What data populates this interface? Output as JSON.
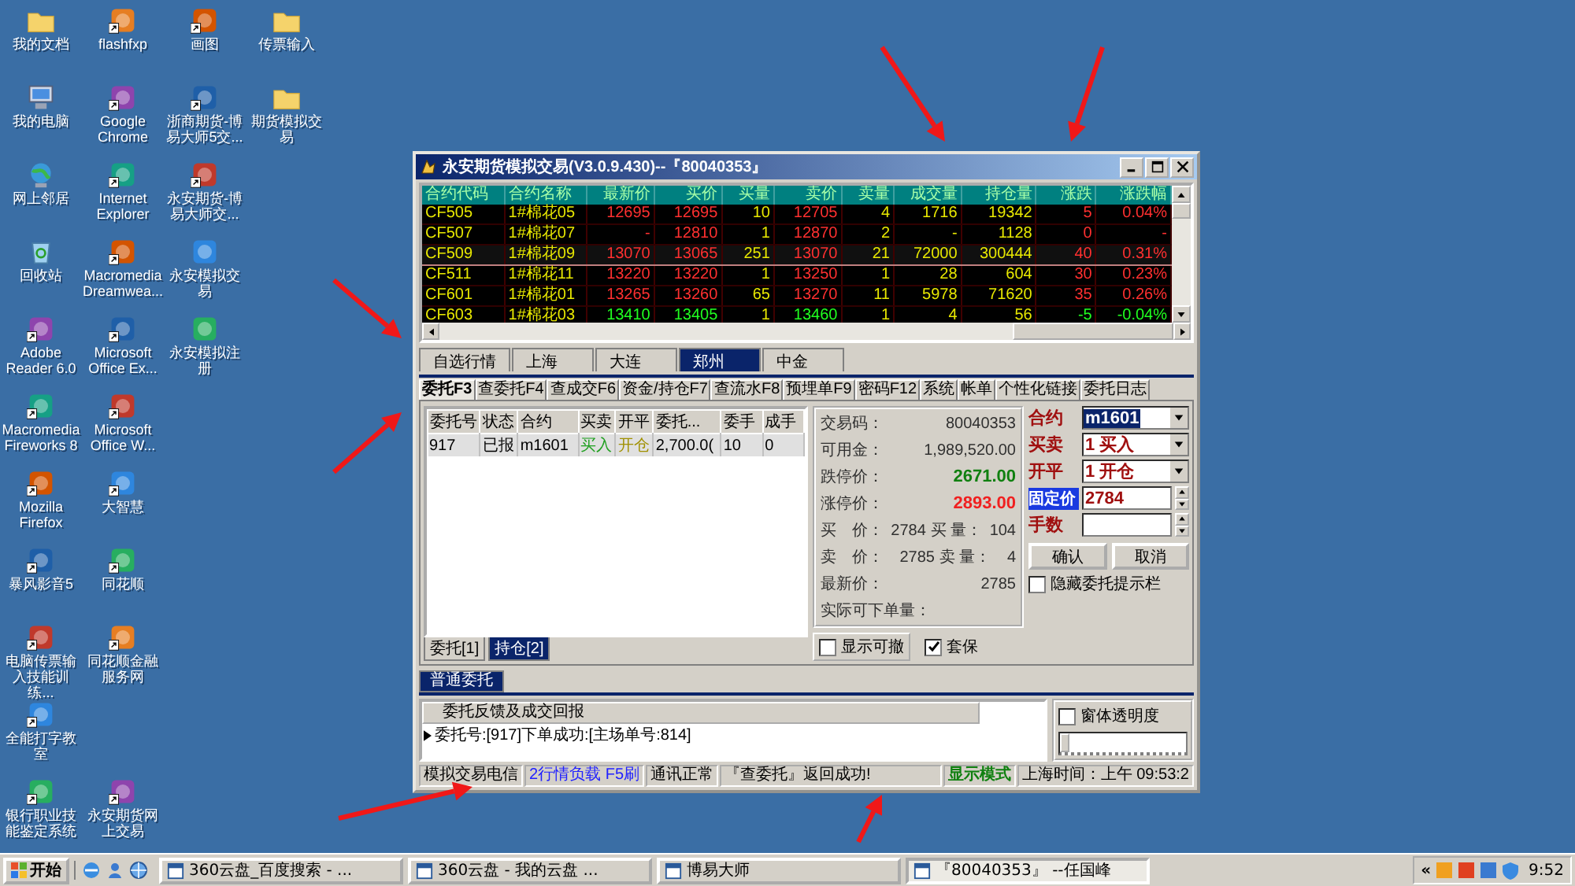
{
  "desktop_columns": [
    [
      {
        "label": "我的文档",
        "shortcut": false
      },
      {
        "label": "我的电脑",
        "shortcut": false
      },
      {
        "label": "网上邻居",
        "shortcut": false
      },
      {
        "label": "回收站",
        "shortcut": false
      },
      {
        "label": "Adobe Reader 6.0",
        "shortcut": true
      },
      {
        "label": "Macromedia Fireworks 8",
        "shortcut": true
      },
      {
        "label": "Mozilla Firefox",
        "shortcut": true
      },
      {
        "label": "暴风影音5",
        "shortcut": true
      },
      {
        "label": "电脑传票输入技能训练...",
        "shortcut": true
      },
      {
        "label": "全能打字教室",
        "shortcut": true
      },
      {
        "label": "银行职业技能鉴定系统",
        "shortcut": true
      }
    ],
    [
      {
        "label": "flashfxp",
        "shortcut": true
      },
      {
        "label": "Google Chrome",
        "shortcut": true
      },
      {
        "label": "Internet Explorer",
        "shortcut": true
      },
      {
        "label": "Macromedia Dreamwea...",
        "shortcut": true
      },
      {
        "label": "Microsoft Office Ex...",
        "shortcut": true
      },
      {
        "label": "Microsoft Office W...",
        "shortcut": true
      },
      {
        "label": "大智慧",
        "shortcut": true
      },
      {
        "label": "同花顺",
        "shortcut": true
      },
      {
        "label": "同花顺金融服务网",
        "shortcut": true
      },
      {
        "label": "永安期货网上交易",
        "shortcut": true
      }
    ],
    [
      {
        "label": "画图",
        "shortcut": true
      },
      {
        "label": "浙商期货-博易大师5交...",
        "shortcut": true
      },
      {
        "label": "永安期货-博易大师交...",
        "shortcut": true
      },
      {
        "label": "永安模拟交易",
        "shortcut": false
      },
      {
        "label": "永安模拟注册",
        "shortcut": false
      }
    ],
    [
      {
        "label": "传票输入",
        "shortcut": false
      },
      {
        "label": "期货模拟交易",
        "shortcut": false
      }
    ]
  ],
  "window": {
    "title": "永安期货模拟交易(V3.0.9.430)--『80040353』"
  },
  "market": {
    "columns": [
      "合约代码",
      "合约名称",
      "最新价",
      "买价",
      "买量",
      "卖价",
      "卖量",
      "成交量",
      "持仓量",
      "涨跌",
      "涨跌幅"
    ],
    "rows": [
      {
        "code": "CF505",
        "name": "1#棉花05",
        "last": "12695",
        "bid": "12695",
        "bid_vol": "10",
        "ask": "12705",
        "ask_vol": "4",
        "volume": "1716",
        "open_interest": "19342",
        "change": "5",
        "change_pct": "0.04%",
        "color": "#ff3030",
        "selected": false
      },
      {
        "code": "CF507",
        "name": "1#棉花07",
        "last": "-",
        "bid": "12810",
        "bid_vol": "1",
        "ask": "12870",
        "ask_vol": "2",
        "volume": "-",
        "open_interest": "1128",
        "change": "0",
        "change_pct": "-",
        "color": "#ff3030",
        "selected": false
      },
      {
        "code": "CF509",
        "name": "1#棉花09",
        "last": "13070",
        "bid": "13065",
        "bid_vol": "251",
        "ask": "13070",
        "ask_vol": "21",
        "volume": "72000",
        "open_interest": "300444",
        "change": "40",
        "change_pct": "0.31%",
        "color": "#ff3030",
        "selected": true
      },
      {
        "code": "CF511",
        "name": "1#棉花11",
        "last": "13220",
        "bid": "13220",
        "bid_vol": "1",
        "ask": "13250",
        "ask_vol": "1",
        "volume": "28",
        "open_interest": "604",
        "change": "30",
        "change_pct": "0.23%",
        "color": "#ff3030",
        "selected": false
      },
      {
        "code": "CF601",
        "name": "1#棉花01",
        "last": "13265",
        "bid": "13260",
        "bid_vol": "65",
        "ask": "13270",
        "ask_vol": "11",
        "volume": "5978",
        "open_interest": "71620",
        "change": "35",
        "change_pct": "0.26%",
        "color": "#ff3030",
        "selected": false
      },
      {
        "code": "CF603",
        "name": "1#棉花03",
        "last": "13410",
        "bid": "13405",
        "bid_vol": "1",
        "ask": "13460",
        "ask_vol": "1",
        "volume": "4",
        "open_interest": "56",
        "change": "-5",
        "change_pct": "-0.04%",
        "color": "#20ff20",
        "selected": false
      }
    ]
  },
  "exchange_tabs": [
    {
      "label": "自选行情",
      "selected": false
    },
    {
      "label": "上海",
      "selected": false
    },
    {
      "label": "大连",
      "selected": false
    },
    {
      "label": "郑州",
      "selected": true
    },
    {
      "label": "中金",
      "selected": false
    }
  ],
  "function_tabs": [
    {
      "label": "委托F3",
      "selected": true
    },
    {
      "label": "查委托F4",
      "selected": false
    },
    {
      "label": "查成交F6",
      "selected": false
    },
    {
      "label": "资金/持仓F7",
      "selected": false
    },
    {
      "label": "查流水F8",
      "selected": false
    },
    {
      "label": "预埋单F9",
      "selected": false
    },
    {
      "label": "密码F12",
      "selected": false
    },
    {
      "label": "系统",
      "selected": false
    },
    {
      "label": "帐单",
      "selected": false
    },
    {
      "label": "个性化链接",
      "selected": false
    },
    {
      "label": "委托日志",
      "selected": false
    }
  ],
  "orders": {
    "columns": [
      "委托号",
      "状态",
      "合约",
      "买卖",
      "开平",
      "委托...",
      "委手",
      "成手"
    ],
    "rows": [
      [
        "917",
        "已报",
        "m1601",
        "买入",
        "开仓",
        "2,700.0(",
        "10",
        "0"
      ]
    ],
    "tabs": [
      {
        "label": "委托[1]",
        "selected": false
      },
      {
        "label": "持仓[2]",
        "selected": true
      }
    ]
  },
  "order_info": {
    "rows": [
      {
        "kind": "plain",
        "label": "交易码：",
        "value": "80040353"
      },
      {
        "kind": "plain",
        "label": "可用金：",
        "value": "1,989,520.00"
      },
      {
        "kind": "down",
        "label": "跌停价：",
        "value": "2671.00"
      },
      {
        "kind": "up",
        "label": "涨停价：",
        "value": "2893.00"
      },
      {
        "kind": "pair",
        "label": "买　价：",
        "value": "2784",
        "label2": "买 量：",
        "value2": "104"
      },
      {
        "kind": "pair",
        "label": "卖　价：",
        "value": "2785",
        "label2": "卖 量：",
        "value2": "4"
      },
      {
        "kind": "plain",
        "label": "最新价：",
        "value": "2785"
      },
      {
        "kind": "label",
        "label": "实际可下单量："
      }
    ],
    "checkboxes": [
      {
        "label": "显示可撤",
        "checked": false
      },
      {
        "label": "套保",
        "checked": true
      }
    ]
  },
  "order_form": {
    "fields": [
      {
        "kind": "select",
        "label": "合约",
        "value": "m1601",
        "highlighted": true,
        "label_highlight": false
      },
      {
        "kind": "select",
        "label": "买卖",
        "value": "1 买入",
        "highlighted": false,
        "label_highlight": false
      },
      {
        "kind": "select",
        "label": "开平",
        "value": "1 开仓",
        "highlighted": false,
        "label_highlight": false
      },
      {
        "kind": "spin",
        "label": "固定价",
        "value": "2784",
        "highlighted": false,
        "label_highlight": true
      },
      {
        "kind": "spin",
        "label": "手数",
        "label_highlight": false
      }
    ],
    "buttons": [
      "确认",
      "取消"
    ],
    "hide_hint": {
      "label": "隐藏委托提示栏",
      "checked": false
    }
  },
  "messages": {
    "tab": {
      "label": "普通委托",
      "selected": true
    },
    "header": "委托反馈及成交回报",
    "rows": [
      "委托号:[917]下单成功:[主场单号:814]"
    ],
    "transparency": {
      "label": "窗体透明度",
      "checked": false,
      "level": 0
    }
  },
  "status_bar": [
    {
      "text": "模拟交易电信",
      "kind": "plain"
    },
    {
      "text": "2行情负载 F5刷",
      "kind": "link"
    },
    {
      "text": "通讯正常",
      "kind": "plain"
    },
    {
      "text": "『查委托』返回成功!",
      "kind": "wide"
    },
    {
      "text": "显示模式",
      "kind": "ok"
    },
    {
      "text": "上海时间：上午 09:53:2",
      "kind": "plain"
    }
  ],
  "taskbar": {
    "start": "开始",
    "tasks": [
      {
        "label": "360云盘_百度搜索 - ...",
        "selected": false
      },
      {
        "label": "360云盘 - 我的云盘 ...",
        "selected": false
      },
      {
        "label": "博易大师",
        "selected": false
      },
      {
        "label": "『80040353』 --任国峰",
        "selected": true
      }
    ],
    "chevron": "«",
    "clock": "9:52"
  }
}
